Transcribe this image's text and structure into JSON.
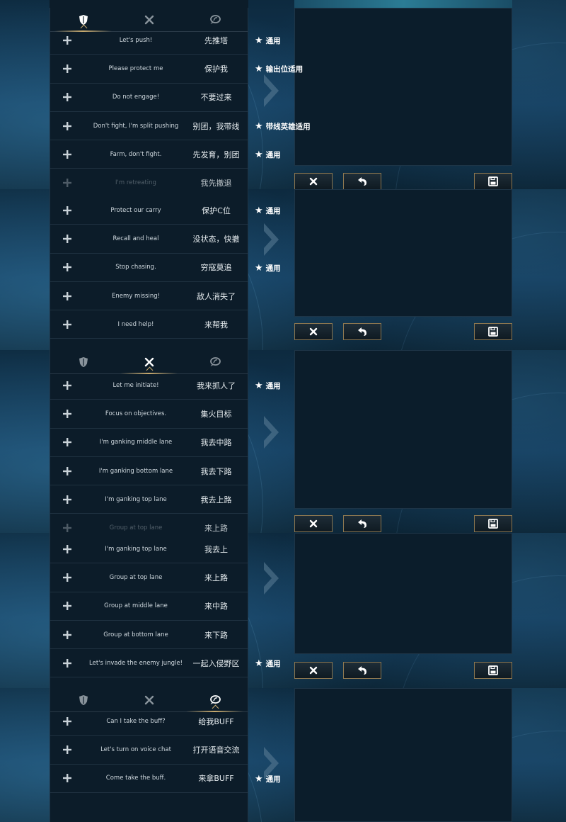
{
  "tags": {
    "general": "通用",
    "carry": "输出位适用",
    "splitpusher": "带线英雄适用"
  },
  "sections": [
    {
      "active_tab": 0,
      "rows": [
        {
          "en": "Let's push!",
          "cn": "先推塔",
          "tag": "general"
        },
        {
          "en": "Please protect me",
          "cn": "保护我",
          "tag": "carry"
        },
        {
          "en": "Do not engage!",
          "cn": "不要过来",
          "tag": null
        },
        {
          "en": "Don't fight, I'm split pushing",
          "cn": "别团，我带线",
          "tag": "splitpusher"
        },
        {
          "en": "Farm, don't fight.",
          "cn": "先发育，别团",
          "tag": "general"
        },
        {
          "en": "I'm retreating",
          "cn": "我先撤退",
          "tag": null,
          "faded": true
        }
      ]
    },
    {
      "active_tab": null,
      "rows": [
        {
          "en": "Protect our carry",
          "cn": "保护C位",
          "tag": "general"
        },
        {
          "en": "Recall and heal",
          "cn": "没状态，快撤",
          "tag": null
        },
        {
          "en": "Stop chasing.",
          "cn": "穷寇莫追",
          "tag": "general"
        },
        {
          "en": "Enemy missing!",
          "cn": "敌人消失了",
          "tag": null
        },
        {
          "en": "I need help!",
          "cn": "来帮我",
          "tag": null
        }
      ]
    },
    {
      "active_tab": 1,
      "rows": [
        {
          "en": "Let me initiate!",
          "cn": "我来抓人了",
          "tag": "general"
        },
        {
          "en": "Focus on objectives.",
          "cn": "集火目标",
          "tag": null
        },
        {
          "en": "I'm ganking middle lane",
          "cn": "我去中路",
          "tag": null
        },
        {
          "en": "I'm ganking bottom lane",
          "cn": "我去下路",
          "tag": null
        },
        {
          "en": "I'm ganking top lane",
          "cn": "我去上路",
          "tag": null
        },
        {
          "en": "Group at top lane",
          "cn": "来上路",
          "tag": null,
          "faded": true
        }
      ]
    },
    {
      "active_tab": null,
      "rows": [
        {
          "en": "I'm ganking top lane",
          "cn": "我去上",
          "tag": null
        },
        {
          "en": "Group at top lane",
          "cn": "来上路",
          "tag": null
        },
        {
          "en": "Group at middle lane",
          "cn": "来中路",
          "tag": null
        },
        {
          "en": "Group at bottom lane",
          "cn": "来下路",
          "tag": null
        },
        {
          "en": "Let's invade the enemy jungle!",
          "cn": "一起入侵野区",
          "tag": "general"
        }
      ]
    },
    {
      "active_tab": 2,
      "rows": [
        {
          "en": "Can I take the buff?",
          "cn": "给我BUFF",
          "tag": null
        },
        {
          "en": "Let's turn on voice chat",
          "cn": "打开语音交流",
          "tag": null
        },
        {
          "en": "Come take the buff.",
          "cn": "来拿BUFF",
          "tag": "general"
        }
      ]
    }
  ],
  "icons": {
    "tab0": "shield-icon",
    "tab1": "crossed-swords-icon",
    "tab2": "chat-bubble-icon",
    "add": "plus-icon",
    "cancel": "close-icon",
    "undo": "undo-icon",
    "save": "save-icon"
  },
  "colors": {
    "accent": "#c8aa6e",
    "panel": "#0c1c29"
  }
}
